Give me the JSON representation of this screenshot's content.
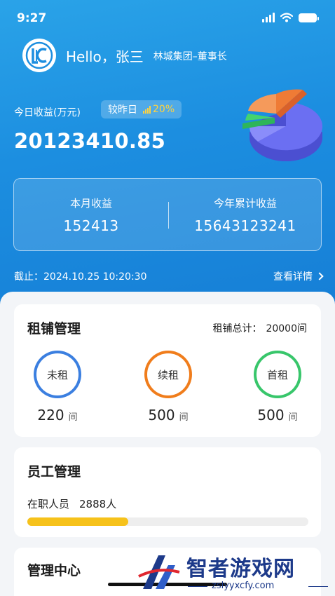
{
  "status_bar": {
    "time": "9:27"
  },
  "header": {
    "greeting": "Hello，张三",
    "company": "林城集团–董事长"
  },
  "income": {
    "today_label": "今日收益(万元)",
    "compare_label": "较昨日",
    "compare_percent": "20%",
    "today_value": "20123410.85"
  },
  "summary": {
    "month_label": "本月收益",
    "month_value": "152413",
    "year_label": "今年累计收益",
    "year_value": "15643123241"
  },
  "asof_text": "截止：2024.10.25 10:20:30",
  "detail_link": "查看详情",
  "rent": {
    "title": "租铺管理",
    "total_label": "租铺总计：",
    "total_value": "20000间",
    "items": [
      {
        "label": "未租",
        "count": "220",
        "unit": "间",
        "color": "#3b7fe0"
      },
      {
        "label": "续租",
        "count": "500",
        "unit": "间",
        "color": "#f07d1c"
      },
      {
        "label": "首租",
        "count": "500",
        "unit": "间",
        "color": "#38c66b"
      }
    ]
  },
  "staff": {
    "title": "员工管理",
    "label": "在职人员",
    "value": "2888人",
    "progress_fraction": 0.36,
    "progress_color": "#f6c21b"
  },
  "management": {
    "title": "管理中心"
  },
  "watermark": {
    "title": "智者游戏网",
    "url": "zslyyxcfy.com"
  },
  "icons": [
    "signal-icon",
    "wifi-icon",
    "battery-icon",
    "logo-icon",
    "bar-chart-icon",
    "pie-chart-icon",
    "chevron-right-icon"
  ]
}
